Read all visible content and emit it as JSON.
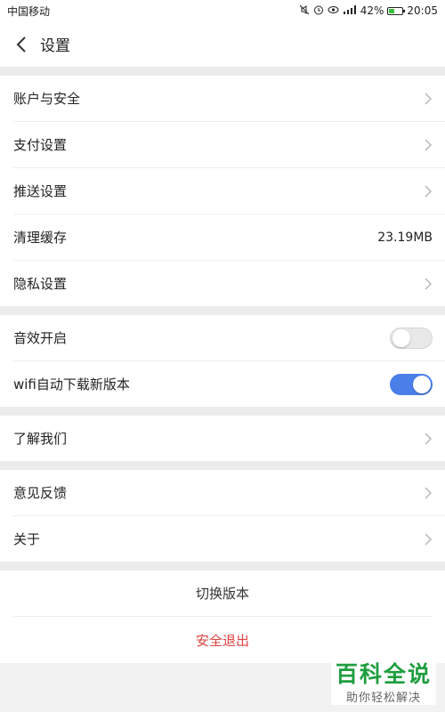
{
  "status_bar": {
    "carrier": "中国移动",
    "battery_percent": "42%",
    "battery_level": 0.42,
    "time": "20:05",
    "icons": [
      "mute-icon",
      "alarm-icon",
      "eye-icon",
      "signal-icon"
    ]
  },
  "header": {
    "title": "设置"
  },
  "groups": {
    "account": {
      "account_security": "账户与安全",
      "payment": "支付设置",
      "push": "推送设置",
      "clear_cache": "清理缓存",
      "cache_size": "23.19MB",
      "privacy": "隐私设置"
    },
    "toggles": {
      "sound_label": "音效开启",
      "sound_on": false,
      "wifi_label": "wifi自动下载新版本",
      "wifi_on": true
    },
    "about_us": {
      "label": "了解我们"
    },
    "feedback": {
      "feedback_label": "意见反馈",
      "about_label": "关于"
    },
    "actions": {
      "switch_version": "切换版本",
      "logout": "安全退出"
    }
  },
  "watermark": {
    "title": "百科全说",
    "subtitle": "助你轻松解决"
  },
  "colors": {
    "accent": "#4a7fea",
    "danger": "#e04040",
    "watermark_green": "#1e9e3f"
  }
}
